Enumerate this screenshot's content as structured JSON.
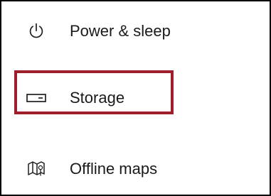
{
  "nav": {
    "items": [
      {
        "label": "Power & sleep",
        "icon": "power-icon"
      },
      {
        "label": "Storage",
        "icon": "storage-icon",
        "highlighted": true
      },
      {
        "label": "Offline maps",
        "icon": "map-icon"
      }
    ]
  },
  "colors": {
    "highlight": "#9f1e2c",
    "text": "#1a1a1a",
    "frame": "#000000",
    "background": "#ffffff"
  }
}
